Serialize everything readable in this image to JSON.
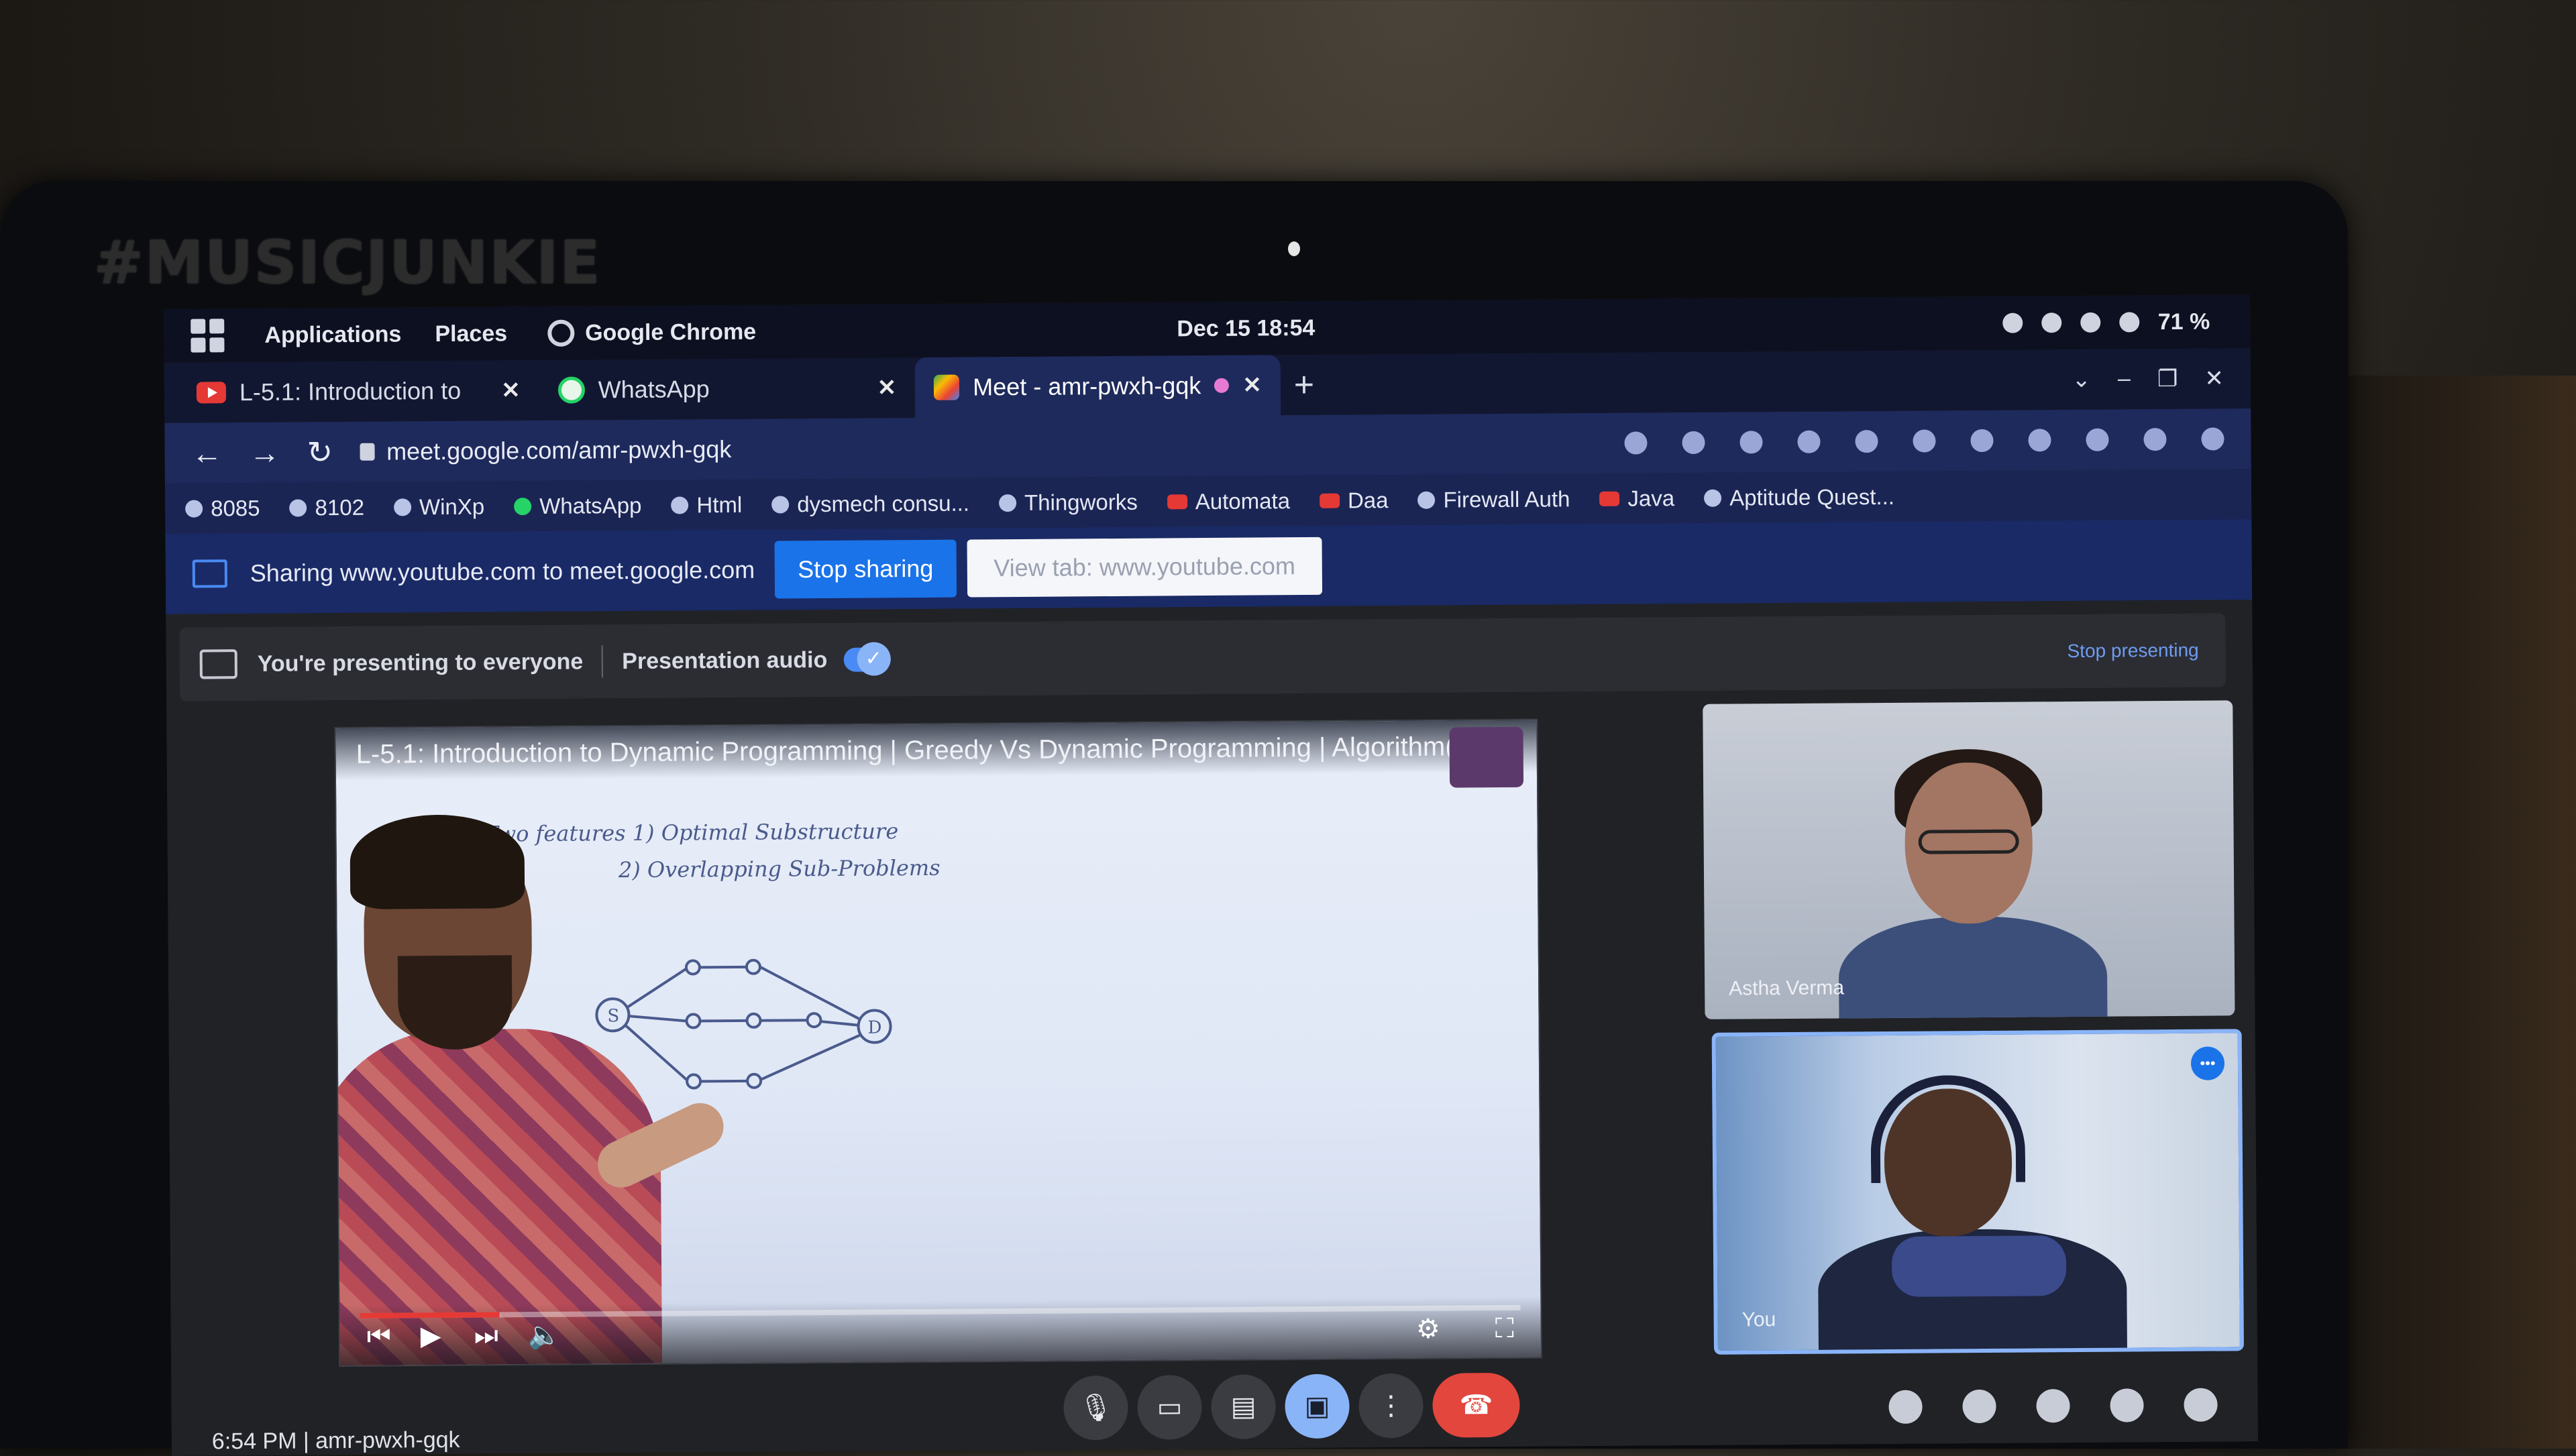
{
  "watermark": "#MUSICJUNKIE",
  "topbar": {
    "menu_applications": "Applications",
    "menu_places": "Places",
    "app_name": "Google Chrome",
    "clock": "Dec 15  18:54",
    "battery": "71 %"
  },
  "tabs": [
    {
      "title": "L-5.1: Introduction to",
      "icon": "youtube-icon"
    },
    {
      "title": "WhatsApp",
      "icon": "whatsapp-icon"
    },
    {
      "title": "Meet - amr-pwxh-gqk",
      "icon": "meet-icon",
      "active": true
    }
  ],
  "address_bar": {
    "url": "meet.google.com/amr-pwxh-gqk"
  },
  "bookmarks": [
    {
      "label": "8085",
      "icon": "b"
    },
    {
      "label": "8102",
      "icon": "b"
    },
    {
      "label": "WinXp",
      "icon": "b"
    },
    {
      "label": "WhatsApp",
      "icon": "g"
    },
    {
      "label": "Html",
      "icon": "b"
    },
    {
      "label": "dysmech consu...",
      "icon": "b"
    },
    {
      "label": "Thingworks",
      "icon": "b"
    },
    {
      "label": "Automata",
      "icon": "r"
    },
    {
      "label": "Daa",
      "icon": "r"
    },
    {
      "label": "Firewall Auth",
      "icon": "b"
    },
    {
      "label": "Java",
      "icon": "r"
    },
    {
      "label": "Aptitude Quest...",
      "icon": "b"
    }
  ],
  "share_bar": {
    "text": "Sharing www.youtube.com to meet.google.com",
    "stop_label": "Stop sharing",
    "view_label": "View tab: www.youtube.com"
  },
  "present_bar": {
    "status": "You're presenting to everyone",
    "audio_label": "Presentation audio",
    "stop_label": "Stop presenting"
  },
  "video": {
    "title": "L-5.1: Introduction to Dynamic Programming | Greedy Vs Dynamic Programming | Algorithm(...",
    "note1": "Two features  1)  Optimal Substructure",
    "note2": "2)  Overlapping Sub-Problems",
    "progress_fraction": 0.12
  },
  "participants": [
    {
      "name": "Astha Verma"
    },
    {
      "name": "You"
    }
  ],
  "meeting_info": "6:54 PM  |  amr-pwxh-gqk"
}
